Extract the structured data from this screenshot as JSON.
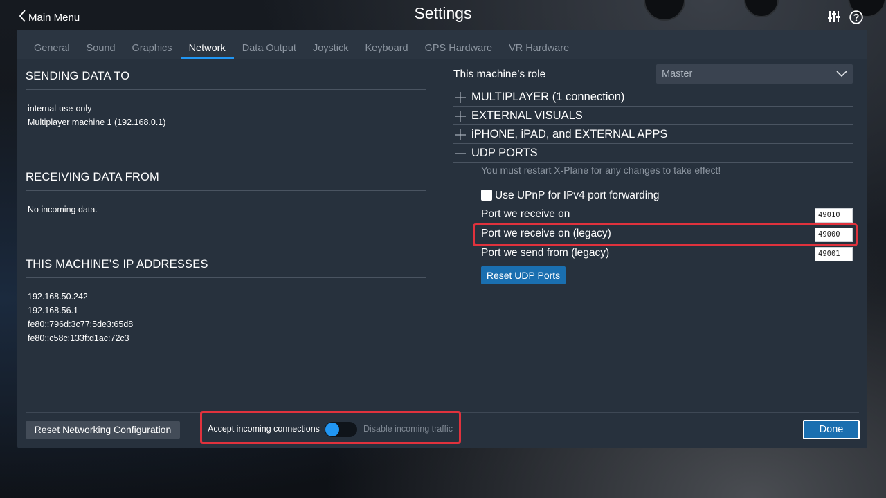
{
  "header": {
    "back_label": "Main Menu",
    "title": "Settings"
  },
  "tabs": [
    {
      "label": "General"
    },
    {
      "label": "Sound"
    },
    {
      "label": "Graphics"
    },
    {
      "label": "Network",
      "active": true
    },
    {
      "label": "Data Output"
    },
    {
      "label": "Joystick"
    },
    {
      "label": "Keyboard"
    },
    {
      "label": "GPS Hardware"
    },
    {
      "label": "VR Hardware"
    }
  ],
  "left": {
    "sending_title": "SENDING DATA TO",
    "sending_items": [
      "internal-use-only",
      "Multiplayer machine 1 (192.168.0.1)"
    ],
    "receiving_title": "RECEIVING DATA FROM",
    "receiving_items": [
      "No incoming data."
    ],
    "ip_title": "THIS MACHINE’S IP ADDRESSES",
    "ip_items": [
      "192.168.50.242",
      "192.168.56.1",
      "fe80::796d:3c77:5de3:65d8",
      "fe80::c58c:133f:d1ac:72c3"
    ]
  },
  "right": {
    "role_label": "This machine’s role",
    "role_value": "Master",
    "sections": [
      {
        "label": "MULTIPLAYER (1 connection)",
        "icon": "plus-icon"
      },
      {
        "label": "EXTERNAL VISUALS",
        "icon": "plus-icon"
      },
      {
        "label": "iPHONE, iPAD, and EXTERNAL APPS",
        "icon": "plus-icon"
      },
      {
        "label": "UDP PORTS",
        "icon": "minus-icon"
      }
    ],
    "restart_note": "You must restart X-Plane for any changes to take effect!",
    "upnp_label": "Use UPnP for IPv4 port forwarding",
    "upnp_checked": false,
    "ports": [
      {
        "label": "Port we receive on",
        "value": "49010"
      },
      {
        "label": "Port we receive on (legacy)",
        "value": "49000"
      },
      {
        "label": "Port we send from (legacy)",
        "value": "49001"
      }
    ],
    "reset_udp_label": "Reset UDP Ports"
  },
  "footer": {
    "reset_network_label": "Reset Networking Configuration",
    "accept_label": "Accept incoming connections",
    "disable_label": "Disable incoming traffic",
    "done_label": "Done"
  },
  "colors": {
    "accent": "#2196f3",
    "highlight": "#e0323d",
    "panel": "#27313d"
  }
}
